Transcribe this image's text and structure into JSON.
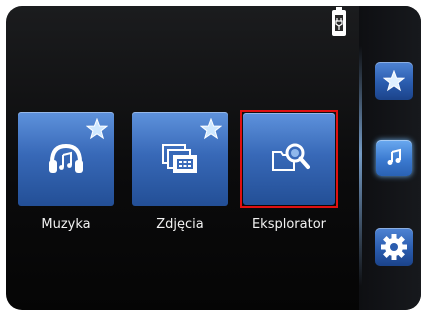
{
  "main": {
    "tiles": [
      {
        "label": "Muzyka",
        "icon": "headphones-music-icon",
        "favorite": true
      },
      {
        "label": "Zdjęcia",
        "icon": "photo-album-icon",
        "favorite": true
      },
      {
        "label": "Eksplorator",
        "icon": "folder-search-icon",
        "favorite": false,
        "highlighted": true
      }
    ]
  },
  "side_dock": {
    "items": [
      {
        "icon": "star-icon"
      },
      {
        "icon": "music-note-icon",
        "active": true
      },
      {
        "icon": "gear-icon"
      }
    ]
  },
  "status_bar": {
    "battery_icon": "battery-charging-icon"
  },
  "colors": {
    "tile_blue": "#3869b8",
    "highlight_red": "#e01010",
    "background": "#0b0b0c"
  }
}
